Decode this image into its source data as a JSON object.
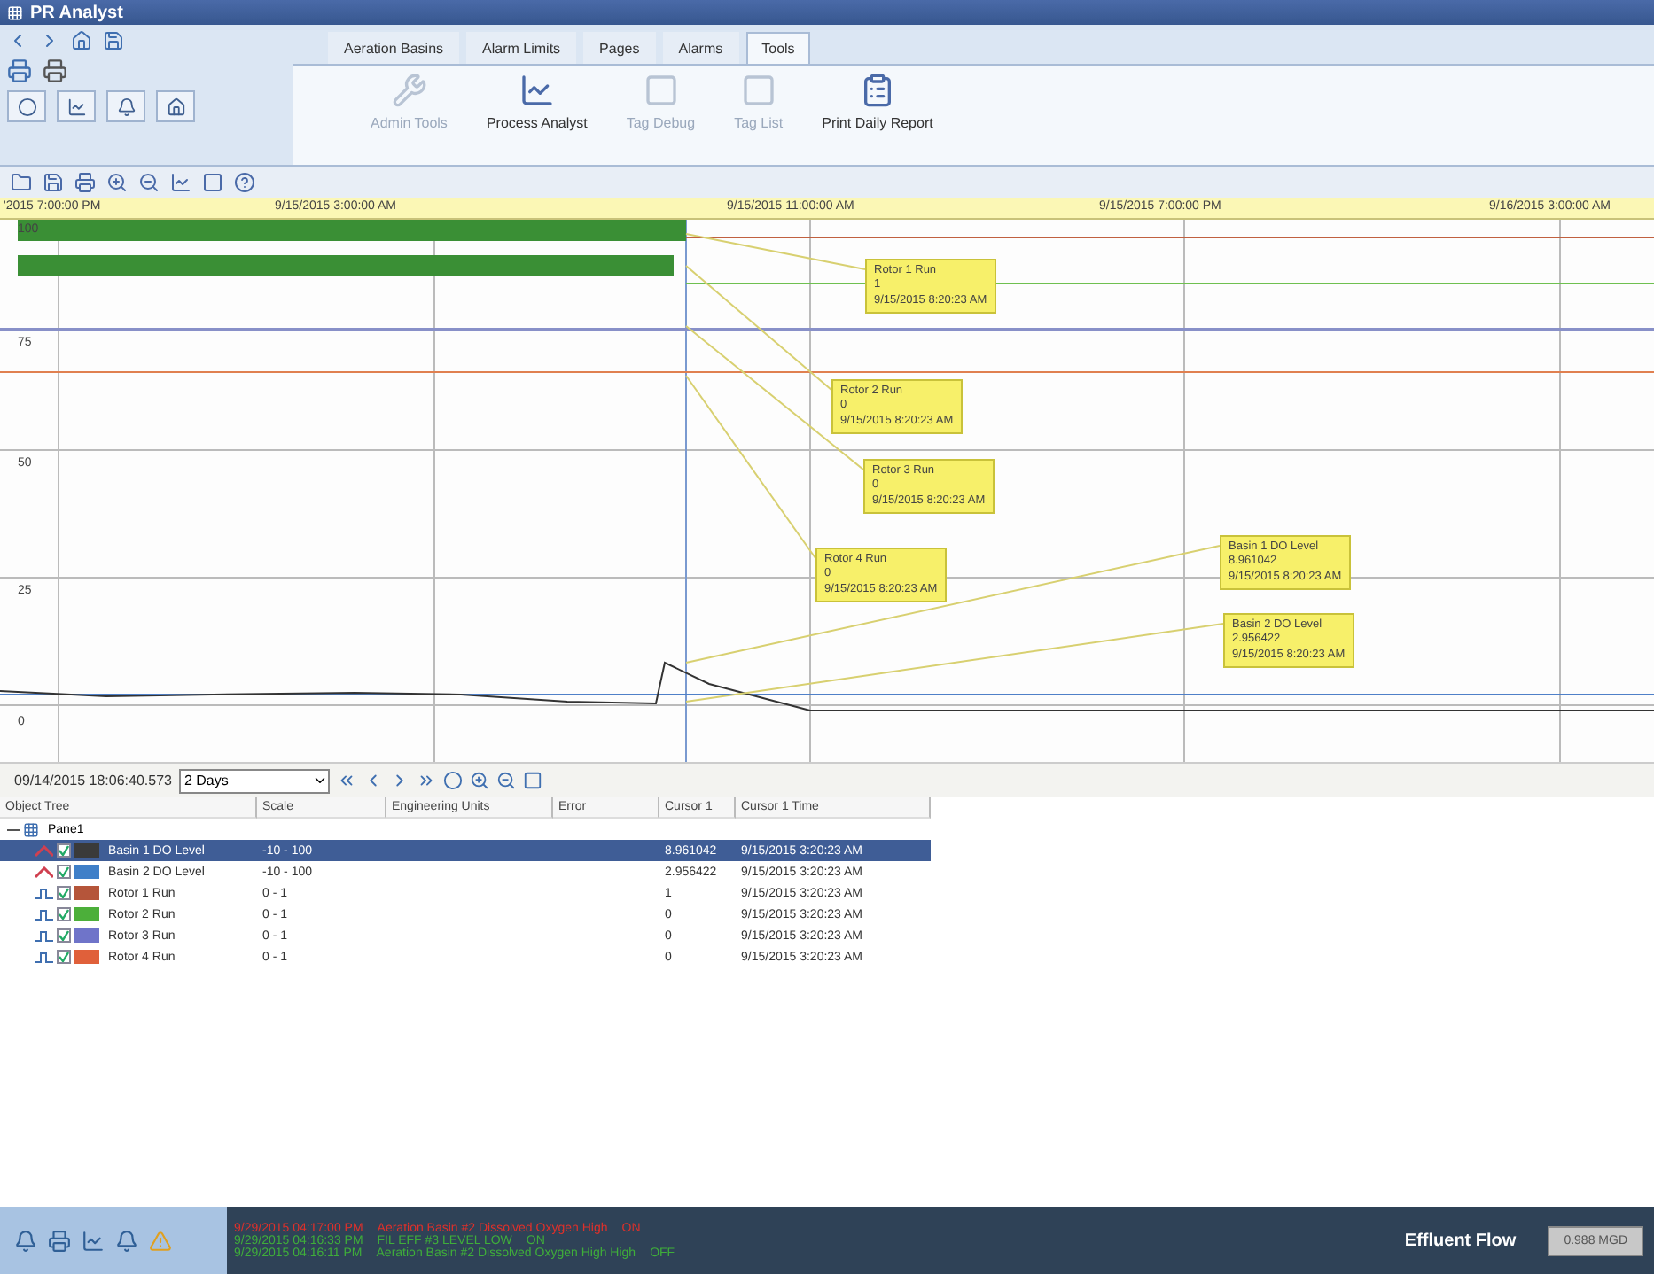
{
  "window": {
    "title": "PR Analyst"
  },
  "ribbon_tabs": [
    {
      "label": "Aeration Basins",
      "selected": false
    },
    {
      "label": "Alarm Limits",
      "selected": false
    },
    {
      "label": "Pages",
      "selected": false
    },
    {
      "label": "Alarms",
      "selected": false
    },
    {
      "label": "Tools",
      "selected": true
    }
  ],
  "ribbon_buttons": [
    {
      "label": "Admin Tools",
      "disabled": true
    },
    {
      "label": "Process Analyst",
      "disabled": false
    },
    {
      "label": "Tag Debug",
      "disabled": true
    },
    {
      "label": "Tag List",
      "disabled": true
    },
    {
      "label": "Print Daily Report",
      "disabled": false
    }
  ],
  "time_axis": [
    "'2015 7:00:00 PM",
    "9/15/2015 3:00:00 AM",
    "9/15/2015 11:00:00 AM",
    "9/15/2015 7:00:00 PM",
    "9/16/2015 3:00:00 AM"
  ],
  "y_axis": [
    "100",
    "75",
    "50",
    "25",
    "0"
  ],
  "cursor_tips": [
    {
      "name": "Rotor 1 Run",
      "value": "1",
      "time": "9/15/2015 8:20:23 AM"
    },
    {
      "name": "Rotor 2 Run",
      "value": "0",
      "time": "9/15/2015 8:20:23 AM"
    },
    {
      "name": "Rotor 3 Run",
      "value": "0",
      "time": "9/15/2015 8:20:23 AM"
    },
    {
      "name": "Rotor 4 Run",
      "value": "0",
      "time": "9/15/2015 8:20:23 AM"
    },
    {
      "name": "Basin 1 DO Level",
      "value": "8.961042",
      "time": "9/15/2015 8:20:23 AM"
    },
    {
      "name": "Basin 2 DO Level",
      "value": "2.956422",
      "time": "9/15/2015 8:20:23 AM"
    }
  ],
  "navigator": {
    "start": "09/14/2015 18:06:40.573",
    "span": "2 Days"
  },
  "table": {
    "columns": [
      "Object Tree",
      "Scale",
      "Engineering Units",
      "Error",
      "Cursor 1",
      "Cursor 1 Time"
    ],
    "pane": {
      "label": "Pane1",
      "expanded": true
    },
    "rows": [
      {
        "kind": "analog",
        "checked": true,
        "color": "#3a3a3a",
        "name": "Basin 1 DO Level",
        "scale": "-10 - 100",
        "cursor": "8.961042",
        "time": "9/15/2015 3:20:23 AM",
        "selected": true
      },
      {
        "kind": "analog",
        "checked": true,
        "color": "#3f7fc8",
        "name": "Basin 2 DO Level",
        "scale": "-10 - 100",
        "cursor": "2.956422",
        "time": "9/15/2015 3:20:23 AM",
        "selected": false
      },
      {
        "kind": "digital",
        "checked": true,
        "color": "#b5553a",
        "name": "Rotor 1 Run",
        "scale": "0 - 1",
        "cursor": "1",
        "time": "9/15/2015 3:20:23 AM",
        "selected": false
      },
      {
        "kind": "digital",
        "checked": true,
        "color": "#4caf3a",
        "name": "Rotor 2 Run",
        "scale": "0 - 1",
        "cursor": "0",
        "time": "9/15/2015 3:20:23 AM",
        "selected": false
      },
      {
        "kind": "digital",
        "checked": true,
        "color": "#6f74c9",
        "name": "Rotor 3 Run",
        "scale": "0 - 1",
        "cursor": "0",
        "time": "9/15/2015 3:20:23 AM",
        "selected": false
      },
      {
        "kind": "digital",
        "checked": true,
        "color": "#e0603a",
        "name": "Rotor 4 Run",
        "scale": "0 - 1",
        "cursor": "0",
        "time": "9/15/2015 3:20:23 AM",
        "selected": false
      }
    ]
  },
  "alarms": [
    {
      "time": "9/29/2015 04:17:00 PM",
      "message": "Aeration Basin #2 Dissolved Oxygen High",
      "state": "ON",
      "color": "#e0302a"
    },
    {
      "time": "9/29/2015 04:16:33 PM",
      "message": "FIL EFF #3 LEVEL LOW",
      "state": "ON",
      "color": "#3fae3a"
    },
    {
      "time": "9/29/2015 04:16:11 PM",
      "message": "Aeration Basin #2 Dissolved Oxygen High High",
      "state": "OFF",
      "color": "#3fae3a"
    }
  ],
  "status": {
    "label": "Effluent Flow",
    "value": "0.988 MGD"
  }
}
